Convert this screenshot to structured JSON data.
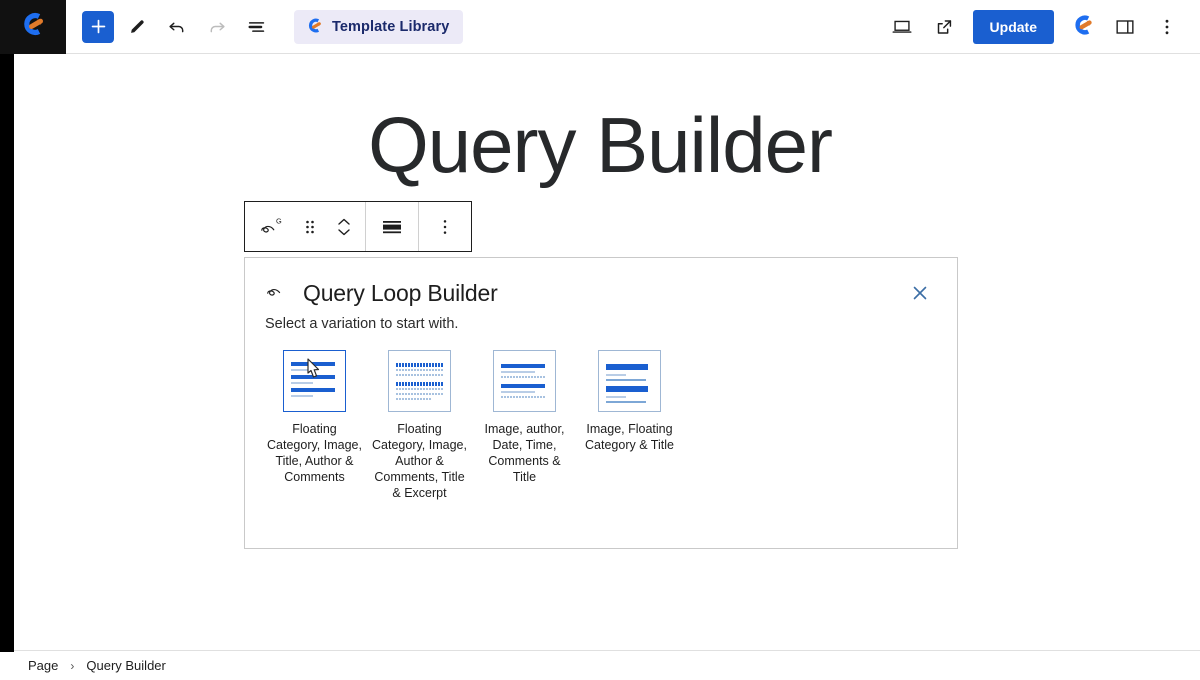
{
  "topbar": {
    "logo_icon": "generateblocks-logo-icon",
    "add_block_label": "+",
    "tools": [
      {
        "name": "add-block-button",
        "icon": "plus-icon",
        "label": "+"
      },
      {
        "name": "edit-tool-button",
        "icon": "pencil-icon",
        "label": ""
      },
      {
        "name": "undo-button",
        "icon": "undo-arrow-icon",
        "label": ""
      },
      {
        "name": "redo-button",
        "icon": "redo-arrow-icon",
        "label": ""
      },
      {
        "name": "document-overview-button",
        "icon": "list-view-icon",
        "label": ""
      }
    ],
    "template_library": {
      "label": "Template Library",
      "icon": "generateblocks-logo-icon"
    },
    "view_button_icon": "desktop-preview-icon",
    "external_button_icon": "view-site-external-link-icon",
    "update_label": "Update",
    "brand_icon": "generateblocks-logo-icon",
    "sidebar_toggle_icon": "settings-sidebar-icon",
    "options_icon": "kebab-menu-icon",
    "accent_color": "#1a5fd0",
    "template_library_bg": "#eceaf7",
    "template_library_text": "#1b2a6b"
  },
  "canvas": {
    "page_title": "Query Builder"
  },
  "block_toolbar": {
    "items": [
      {
        "name": "block-type-query-loop-button",
        "icon": "query-loop-icon"
      },
      {
        "name": "drag-handle",
        "icon": "drag-dots-icon"
      },
      {
        "name": "move-updown-button",
        "icon": "chevron-up-down-icon"
      },
      {
        "name": "align-button",
        "icon": "align-wide-icon"
      },
      {
        "name": "more-options-button",
        "icon": "kebab-menu-icon"
      }
    ]
  },
  "modal": {
    "icon": "query-loop-icon",
    "title": "Query Loop Builder",
    "subtitle": "Select a variation to start with.",
    "close_icon": "close-x-icon",
    "close_color": "#3b6ea5",
    "variations": [
      {
        "label": "Floating Category, Image, Title, Author & Comments",
        "selected": true,
        "hovered": true
      },
      {
        "label": "Floating Category, Image, Author & Comments, Title & Excerpt",
        "selected": false,
        "hovered": false
      },
      {
        "label": "Image, author, Date, Time, Comments & Title",
        "selected": false,
        "hovered": false
      },
      {
        "label": "Image, Floating Category & Title",
        "selected": false,
        "hovered": false
      }
    ]
  },
  "footer": {
    "breadcrumb": [
      {
        "label": "Page"
      },
      {
        "label": "Query Builder"
      }
    ],
    "separator": "›"
  }
}
